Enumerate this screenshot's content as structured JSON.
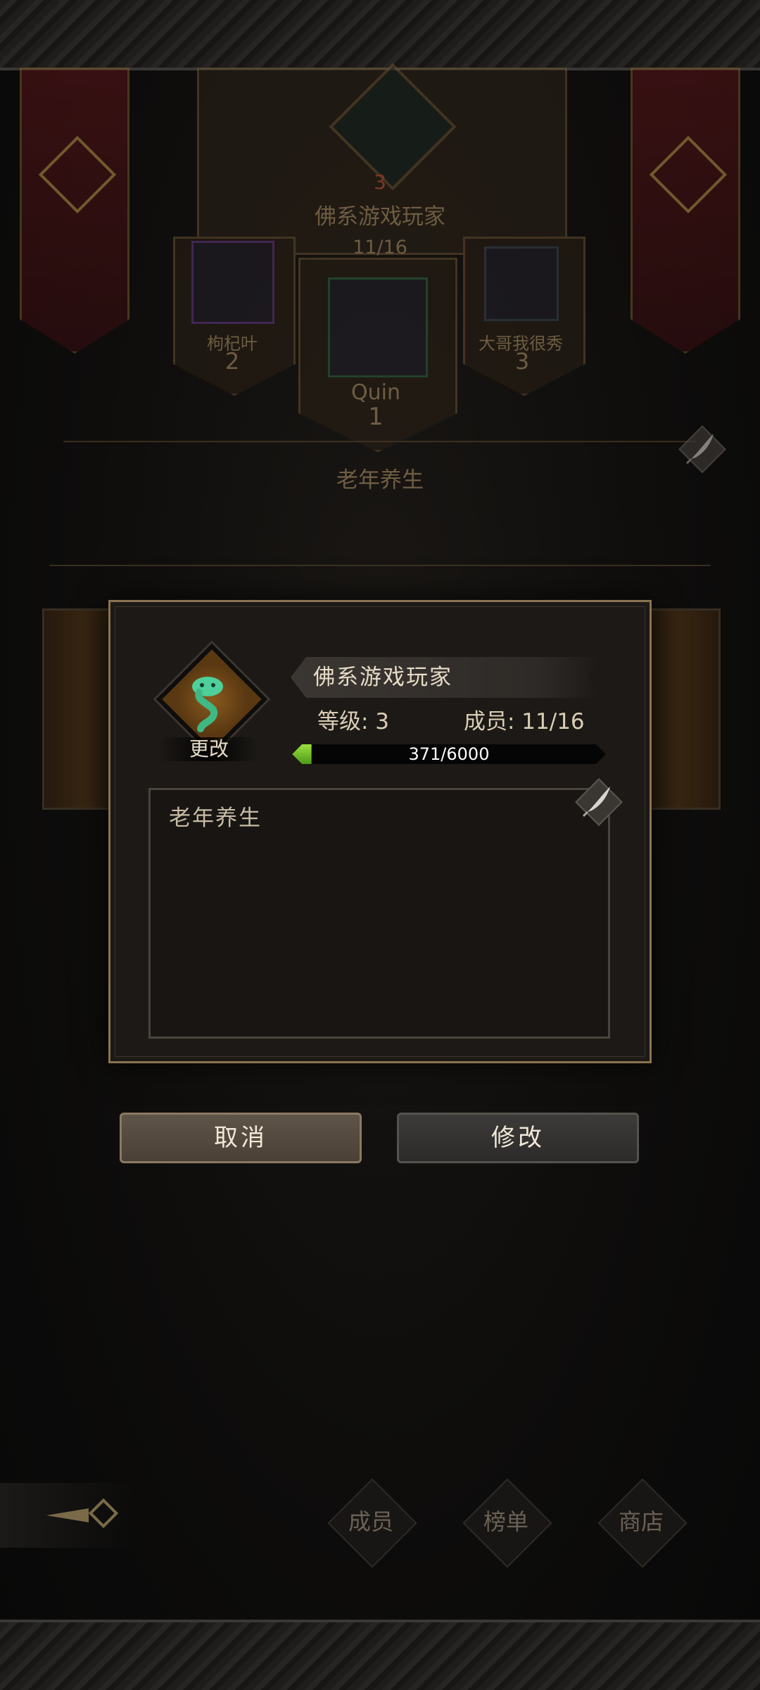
{
  "background": {
    "guild_name": "佛系游戏玩家",
    "guild_level_badge": "3",
    "member_count": "11/16",
    "notice": "老年养生",
    "ranking": [
      {
        "name": "Quin",
        "rank": "1"
      },
      {
        "name": "枸杞叶",
        "rank": "2"
      },
      {
        "name": "大哥我很秀",
        "rank": "3"
      }
    ]
  },
  "dialog": {
    "change_label": "更改",
    "guild_name": "佛系游戏玩家",
    "level_text": "等级: 3",
    "members_text": "成员: 11/16",
    "xp": {
      "current": 371,
      "max": 6000,
      "label": "371/6000",
      "fill_fraction": 0.062
    },
    "description": "老年养生"
  },
  "buttons": {
    "cancel": "取消",
    "modify": "修改"
  },
  "nav": {
    "members": "成员",
    "ranking": "榜单",
    "shop": "商店"
  },
  "icons": {
    "edit": "quill-pen-icon",
    "emblem": "snake-emblem-icon",
    "back": "back-arrow-icon"
  },
  "colors": {
    "xp_fill": "#7bc12e",
    "gold_trim": "#8a7350",
    "banner_red": "#5a1518"
  }
}
